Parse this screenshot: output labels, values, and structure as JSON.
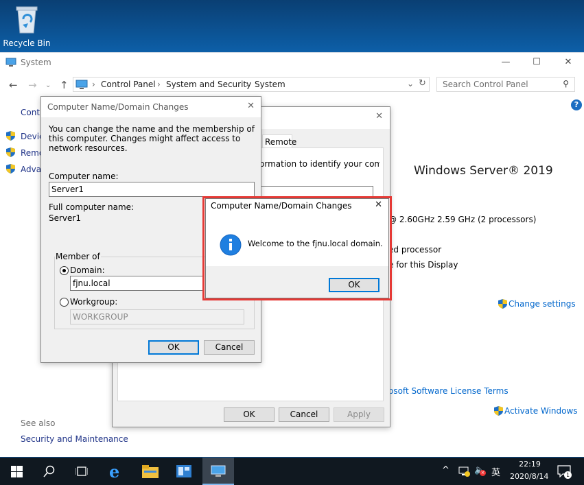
{
  "desktop": {
    "recycle_bin_label": "Recycle Bin"
  },
  "window": {
    "title": "System",
    "controls": {
      "minimize": "—",
      "maximize": "☐",
      "close": "✕"
    },
    "breadcrumb": [
      "Control Panel",
      "System and Security",
      "System"
    ],
    "search_placeholder": "Search Control Panel",
    "sidebar_visible": [
      "Contr",
      "Devic",
      "Remo",
      "Adva"
    ],
    "see_also": "See also",
    "security_link": "Security and Maintenance",
    "edition": "Windows Server® 2019",
    "cpu": "@ 2.60GHz   2.59 GHz  (2 processors)",
    "processor_fragment": "ed processor",
    "display_fragment": "e for this Display",
    "change_settings": "Change settings",
    "license_fragment": "osoft Software License Terms",
    "activate": "Activate Windows"
  },
  "system_properties": {
    "tab_remote": "Remote",
    "text_fragment": "ormation to identify your computer",
    "ok": "OK",
    "cancel": "Cancel",
    "apply": "Apply"
  },
  "name_dialog": {
    "title": "Computer Name/Domain Changes",
    "description": "You can change the name and the membership of this computer. Changes might affect access to network resources.",
    "computer_name_label": "Computer name:",
    "computer_name_value": "Server1",
    "full_name_label": "Full computer name:",
    "full_name_value": "Server1",
    "member_of": "Member of",
    "domain_label": "Domain:",
    "domain_value": "fjnu.local",
    "workgroup_label": "Workgroup:",
    "workgroup_value": "WORKGROUP",
    "ok": "OK",
    "cancel": "Cancel"
  },
  "welcome_dialog": {
    "title": "Computer Name/Domain Changes",
    "message": "Welcome to the fjnu.local domain.",
    "ok": "OK",
    "icon": "info-icon",
    "highlight_color": "#e53935"
  },
  "taskbar": {
    "time": "22:19",
    "date": "2020/8/14",
    "ime": "英",
    "notification_count": "1"
  }
}
